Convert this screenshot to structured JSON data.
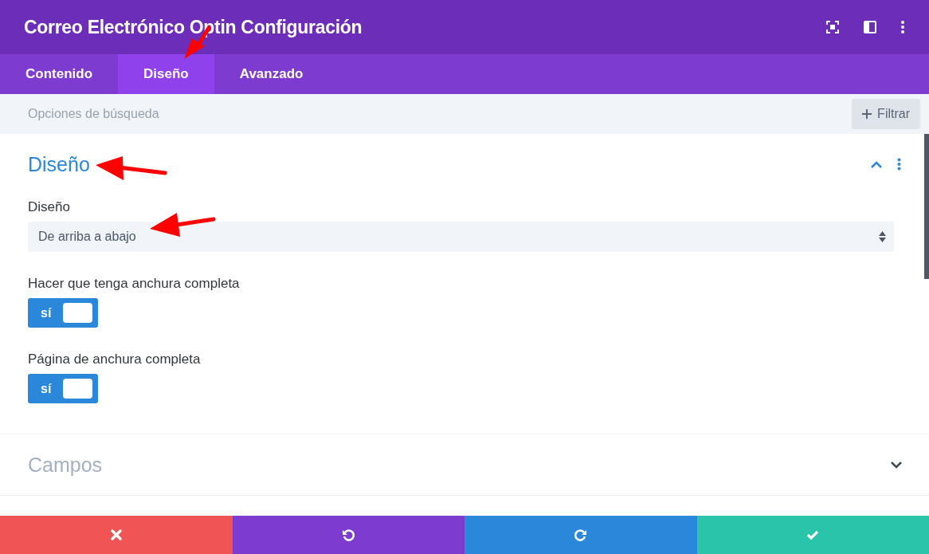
{
  "window": {
    "title": "Correo Electrónico Optin Configuración"
  },
  "tabs": [
    {
      "label": "Contenido",
      "selected": false
    },
    {
      "label": "Diseño",
      "selected": true
    },
    {
      "label": "Avanzado",
      "selected": false
    }
  ],
  "search": {
    "placeholder": "Opciones de búsqueda",
    "filter_button": "Filtrar"
  },
  "sections": [
    {
      "title": "Diseño",
      "expanded": true,
      "fields": [
        {
          "kind": "select",
          "label": "Diseño",
          "value": "De arriba a abajo"
        },
        {
          "kind": "toggle",
          "label": "Hacer que tenga anchura completa",
          "on": true,
          "text": "sí"
        },
        {
          "kind": "toggle",
          "label": "Página de anchura completa",
          "on": true,
          "text": "sí"
        }
      ]
    },
    {
      "title": "Campos",
      "expanded": false
    }
  ],
  "footer_buttons": [
    {
      "kind": "cancel"
    },
    {
      "kind": "undo"
    },
    {
      "kind": "redo"
    },
    {
      "kind": "save"
    }
  ]
}
